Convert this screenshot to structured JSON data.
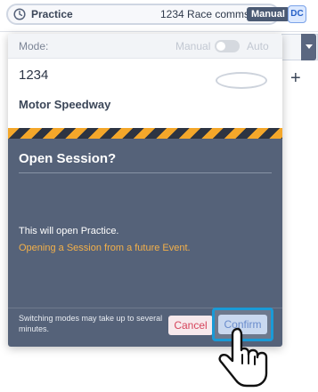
{
  "topbar": {
    "session_title": "Practice",
    "comms_label": "1234 Race comms",
    "mode_badge": "Manual",
    "user_initials": "DC"
  },
  "panel": {
    "mode_label": "Mode:",
    "mode_manual": "Manual",
    "mode_auto": "Auto",
    "event_code": "1234",
    "venue": "Motor Speedway"
  },
  "modal": {
    "title": "Open Session?",
    "message": "This will open Practice.",
    "warning": "Opening a Session from a future Event.",
    "footnote": "Switching modes may take up to several minutes.",
    "cancel_label": "Cancel",
    "confirm_label": "Confirm"
  },
  "background": {
    "add_symbol": "+"
  },
  "colors": {
    "modal_bg": "#556279",
    "warning_text": "#f3b04a",
    "stripe_amber": "#f4a72a",
    "cancel_text": "#d6455c",
    "confirm_highlight": "#1a9ad6",
    "badge_bg": "#4b5a73"
  },
  "icons": {
    "session": "clock-icon",
    "dropdown": "chevron-down-icon",
    "add": "plus-icon",
    "cursor": "hand-pointer-icon"
  }
}
